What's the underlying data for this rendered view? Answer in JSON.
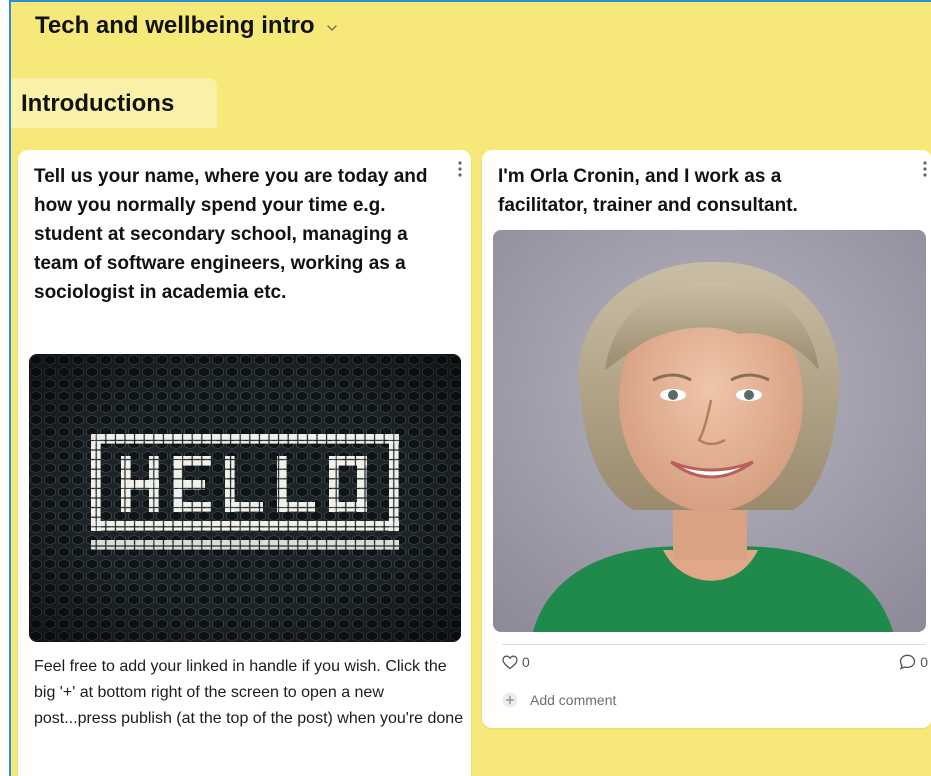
{
  "board": {
    "title": "Tech and wellbeing intro",
    "background_color": "#f6e97a",
    "accent_border_color": "#2f8fd6"
  },
  "section": {
    "title": "Introductions"
  },
  "posts": [
    {
      "title": "Tell us your name, where you are today and how you normally spend your time e.g. student at secondary school, managing a team of software engineers, working as a sociologist in academia etc.",
      "image_text": "HELLO",
      "body": "Feel free to add your linked in handle if you wish. Click the big '+' at bottom right of the screen to open a new post...press publish (at the top of the post) when you're done"
    },
    {
      "title": "I'm Orla Cronin, and I work as a facilitator, trainer and consultant.",
      "likes": "0",
      "comments": "0",
      "add_comment_label": "Add comment"
    }
  ],
  "icons": {
    "board_menu": "chevron-down-icon",
    "post_menu": "kebab-menu-icon",
    "like": "heart-icon",
    "comment": "comment-bubble-icon",
    "add_comment": "plus-circle-icon"
  }
}
